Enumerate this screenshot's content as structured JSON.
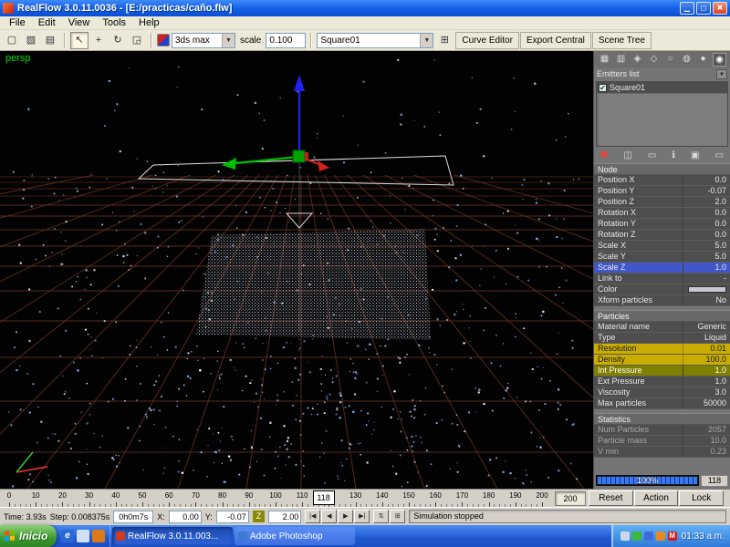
{
  "icons": {
    "dropdown_arrow": "▼",
    "check": "✔",
    "duplicate": "⊞"
  },
  "window": {
    "title": "RealFlow 3.0.11.0036 - [E:/practicas/caño.flw]",
    "minimize": "▁",
    "restore": "◻",
    "close": "✖"
  },
  "menu": {
    "items": [
      "File",
      "Edit",
      "View",
      "Tools",
      "Help"
    ]
  },
  "toolbar": {
    "file_icons": [
      {
        "name": "new-file",
        "glyph": "▢"
      },
      {
        "name": "open-file",
        "glyph": "▨"
      },
      {
        "name": "save-file",
        "glyph": "▤"
      }
    ],
    "tool_icons": [
      {
        "name": "select-tool",
        "glyph": "↖",
        "active": true
      },
      {
        "name": "move-tool",
        "glyph": "+"
      },
      {
        "name": "rotate-tool",
        "glyph": "↻"
      },
      {
        "name": "scale-tool",
        "glyph": "◲"
      }
    ],
    "preset_value": "3ds max",
    "scale_label": "scale",
    "scale_value": "0.100",
    "node_selector": "Square01",
    "action_buttons": [
      "Curve Editor",
      "Export Central",
      "Scene Tree"
    ]
  },
  "viewport": {
    "camera_label": "persp"
  },
  "side_panel": {
    "tab_icons": [
      "▦",
      "▥",
      "◈",
      "◇",
      "○",
      "◍",
      "●",
      "◉"
    ],
    "emitters_list_label": "Emitters list",
    "emitters": [
      {
        "name": "Square01",
        "checked": true
      }
    ],
    "tool_icons": [
      {
        "name": "delete-emitter",
        "glyph": "✖",
        "red": true
      },
      {
        "name": "display-mode-1",
        "glyph": "◫"
      },
      {
        "name": "display-mode-2",
        "glyph": "▭"
      },
      {
        "name": "info",
        "glyph": "ℹ"
      },
      {
        "name": "display-mode-3",
        "glyph": "▣"
      },
      {
        "name": "display-mode-4",
        "glyph": "▭"
      }
    ],
    "sections": {
      "node": {
        "title": "Node",
        "rows": [
          {
            "label": "Position X",
            "value": "0.0"
          },
          {
            "label": "Position Y",
            "value": "-0.07"
          },
          {
            "label": "Position Z",
            "value": "2.0"
          },
          {
            "label": "Rotation X",
            "value": "0.0"
          },
          {
            "label": "Rotation Y",
            "value": "0.0"
          },
          {
            "label": "Rotation Z",
            "value": "0.0"
          },
          {
            "label": "Scale X",
            "value": "5.0"
          },
          {
            "label": "Scale Y",
            "value": "5.0"
          },
          {
            "label": "Scale Z",
            "value": "1.0",
            "hl": "blue"
          },
          {
            "label": "Link to",
            "value": "-"
          },
          {
            "label": "Color",
            "value": "",
            "swatch": true
          },
          {
            "label": "Xform particles",
            "value": "No"
          }
        ]
      },
      "particles": {
        "title": "Particles",
        "rows": [
          {
            "label": "Material name",
            "value": "Generic"
          },
          {
            "label": "Type",
            "value": "Liquid"
          },
          {
            "label": "Resolution",
            "value": "0.01",
            "hl": "yellow"
          },
          {
            "label": "Density",
            "value": "100.0",
            "hl": "yellow"
          },
          {
            "label": "Int Pressure",
            "value": "1.0",
            "hl": "olive"
          },
          {
            "label": "Ext Pressure",
            "value": "1.0"
          },
          {
            "label": "Viscosity",
            "value": "3.0"
          },
          {
            "label": "Max particles",
            "value": "50000"
          }
        ]
      },
      "statistics": {
        "title": "Statistics",
        "rows": [
          {
            "label": "Num Particles",
            "value": "2057",
            "dim": true
          },
          {
            "label": "Particle mass",
            "value": "10.0",
            "dim": true
          },
          {
            "label": "V min",
            "value": "0.23",
            "dim": true
          }
        ]
      }
    },
    "progress": {
      "percent": "100%",
      "frame": "118"
    }
  },
  "timeline": {
    "start": 0,
    "end": 200,
    "step": 10,
    "current_frame": "118",
    "end_frame": "200",
    "buttons": [
      "Reset",
      "Action",
      "Lock"
    ]
  },
  "transport": {
    "time": "Time: 3.93s",
    "step": "Step: 0.008375s",
    "elapsed": "0h0m7s",
    "x_label": "X:",
    "x_value": "0.00",
    "y_label": "Y:",
    "y_value": "-0.07",
    "z_label": "Z",
    "z_value": "2.00",
    "playback": [
      "|◀",
      "◀",
      "▶",
      "▶|"
    ],
    "extra_icons": [
      "⇅",
      "⊞"
    ],
    "status": "Simulation stopped"
  },
  "taskbar": {
    "start_label": "Inicio",
    "quicklaunch": [
      {
        "name": "internet-explorer",
        "glyph": "e",
        "color": "#2a68d8"
      },
      {
        "name": "show-desktop",
        "glyph": "",
        "color": "#cfe0f2"
      },
      {
        "name": "media-player",
        "glyph": "",
        "color": "#e07818"
      }
    ],
    "tasks": [
      {
        "label": "RealFlow 3.0.11.003...",
        "active": true,
        "icon_color": "#d03a1e"
      },
      {
        "label": "Adobe Photoshop",
        "active": false,
        "icon_color": "#3a7bd0"
      }
    ],
    "tray_icons": [
      {
        "name": "tray-volume",
        "color": "#cfd8e8",
        "glyph": ""
      },
      {
        "name": "tray-green",
        "color": "#3cb83c",
        "glyph": ""
      },
      {
        "name": "tray-blue",
        "color": "#3c6cd8",
        "glyph": ""
      },
      {
        "name": "tray-orange",
        "color": "#e88820",
        "glyph": ""
      },
      {
        "name": "tray-mcafee",
        "color": "#d01818",
        "glyph": "M"
      }
    ],
    "clock": "01:33 a.m."
  }
}
